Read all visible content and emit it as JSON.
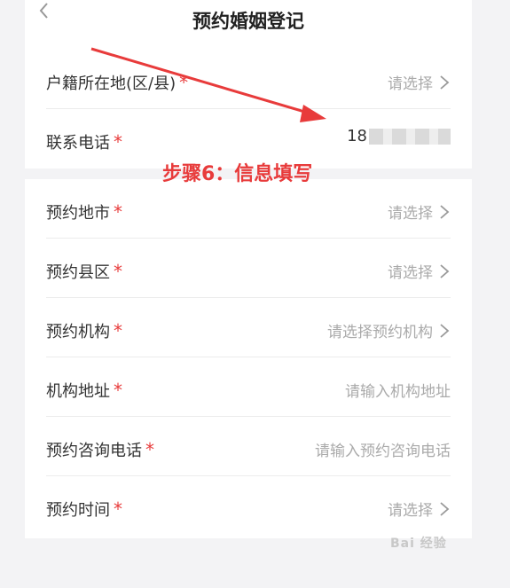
{
  "header": {
    "title": "预约婚姻登记",
    "back_icon": "chevron-left-icon"
  },
  "section1": [
    {
      "label": "户籍所在地(区/县)",
      "value": "请选择",
      "required": "*"
    },
    {
      "label": "联系电话",
      "value": "18",
      "required": "*"
    }
  ],
  "section2": [
    {
      "label": "预约地市",
      "value": "请选择",
      "required": "*"
    },
    {
      "label": "预约县区",
      "value": "请选择",
      "required": "*"
    },
    {
      "label": "预约机构",
      "value": "请选择预约机构",
      "required": "*"
    },
    {
      "label": "机构地址",
      "value": "请输入机构地址",
      "required": "*"
    },
    {
      "label": "预约咨询电话",
      "value": "请输入预约咨询电话",
      "required": "*"
    },
    {
      "label": "预约时间",
      "value": "请选择",
      "required": "*"
    }
  ],
  "annotation": "步骤6：信息填写",
  "watermark": "Bai 经验",
  "colors": {
    "required": "#e83b3b",
    "annotation": "#e83b3b",
    "placeholder": "#aaaaaa"
  }
}
